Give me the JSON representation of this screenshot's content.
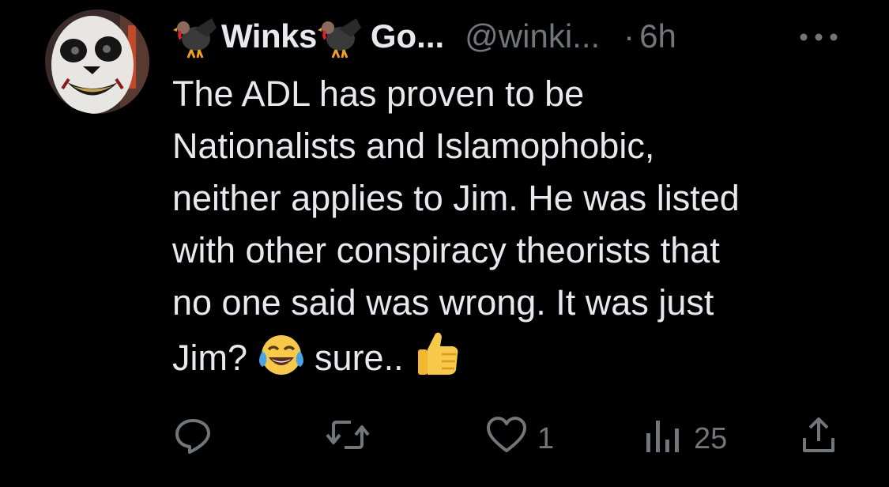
{
  "post": {
    "author": {
      "display_name": "Winks",
      "display_name_suffix": "Go...",
      "handle": "@winki...",
      "separator": "·",
      "time": "6h"
    },
    "text_lines": [
      "The ADL has proven to be",
      "Nationalists and Islamophobic,",
      "neither applies to Jim. He was listed",
      "with other conspiracy theorists that",
      "no one said was wrong. It was just"
    ],
    "last_line_start": "Jim?",
    "last_line_middle": "sure..",
    "emojis": [
      "tears-of-joy-emoji",
      "thumbs-up-emoji"
    ],
    "actions": {
      "reply": {
        "icon": "reply-icon",
        "count": ""
      },
      "repost": {
        "icon": "repost-icon",
        "count": ""
      },
      "like": {
        "icon": "heart-icon",
        "count": "1"
      },
      "views": {
        "icon": "analytics-icon",
        "count": "25"
      },
      "share": {
        "icon": "share-icon"
      }
    }
  },
  "colors": {
    "background": "#000000",
    "text_primary": "#e7e9ea",
    "text_secondary": "#71767b"
  }
}
